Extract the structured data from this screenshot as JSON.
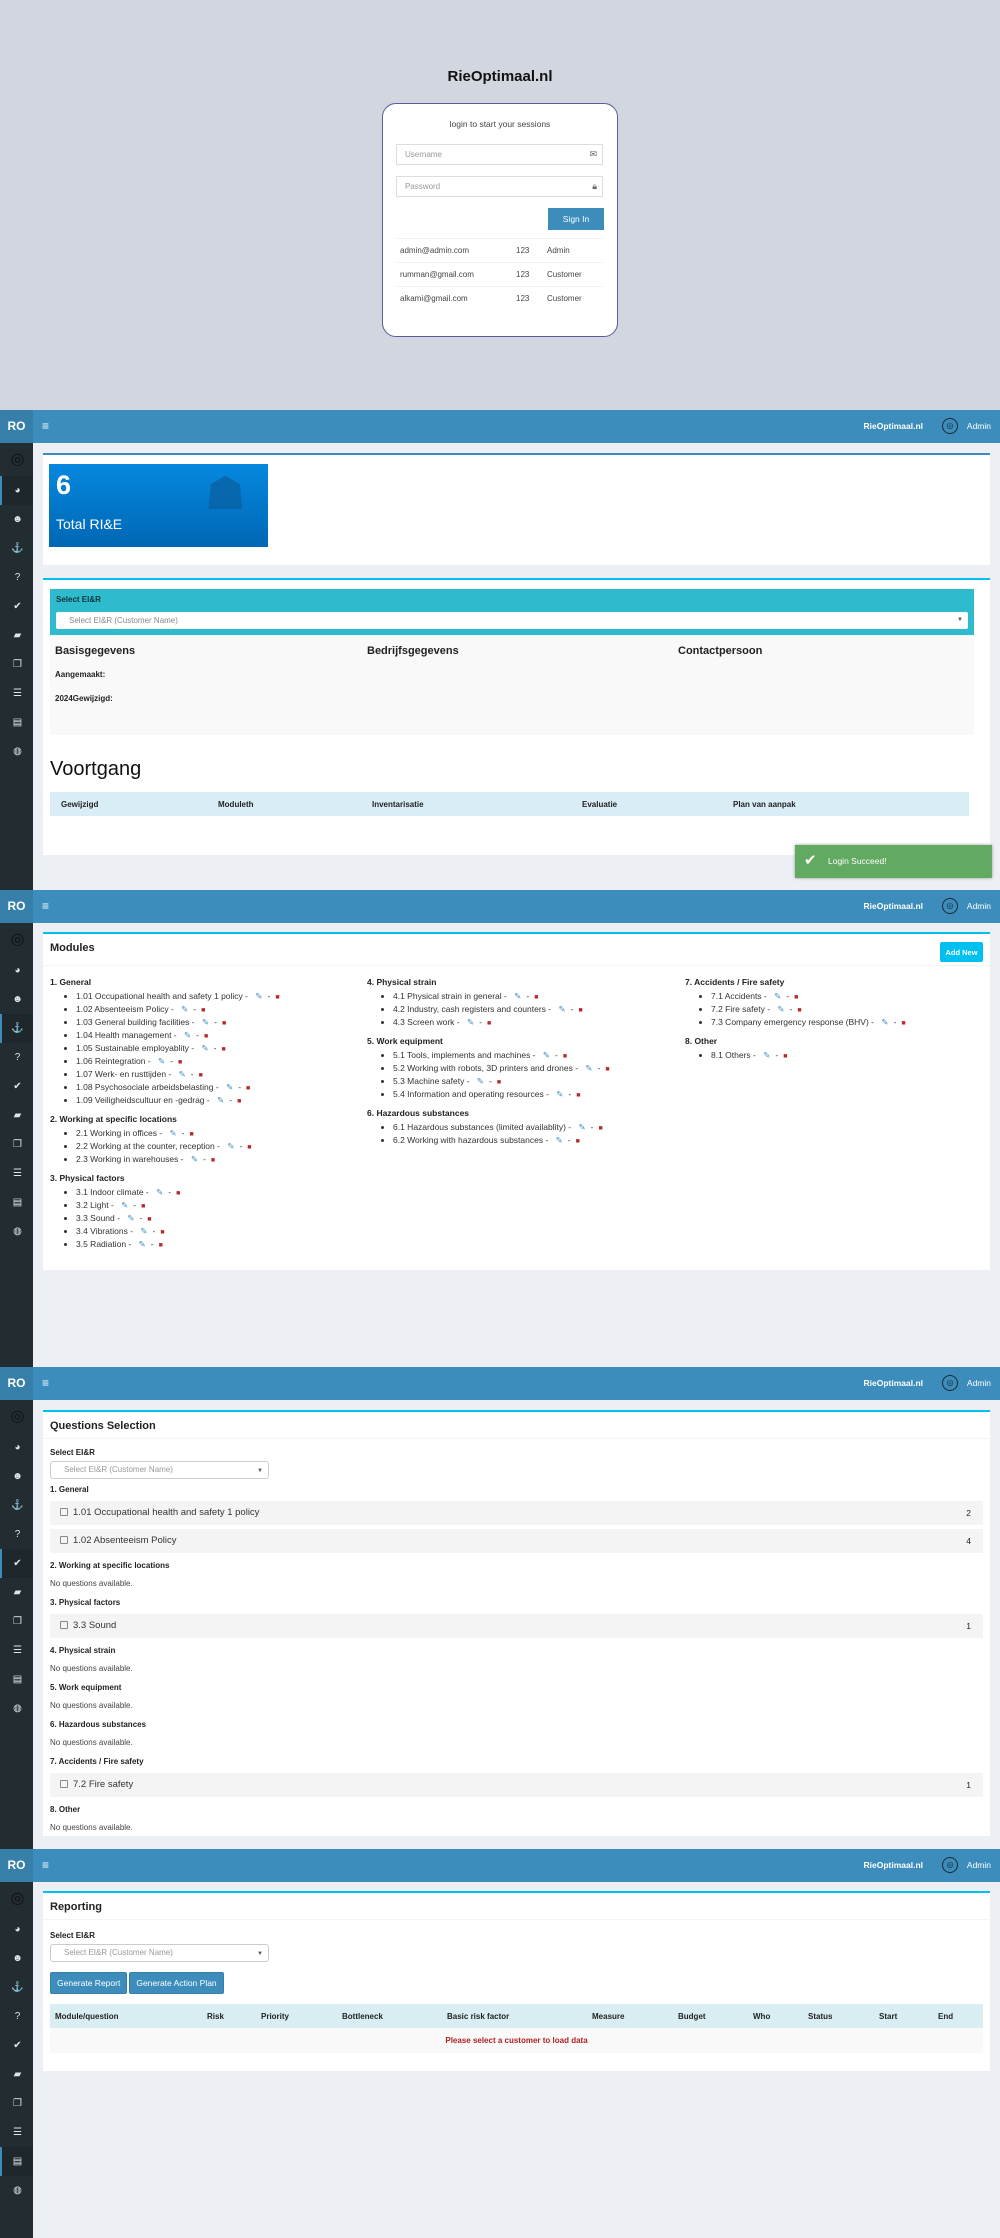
{
  "login": {
    "title": "RieOptimaal.nl",
    "subtitle": "login to start your sessions",
    "username_placeholder": "Username",
    "password_placeholder": "Password",
    "sign_in": "Sign In",
    "credentials": [
      {
        "email": "admin@admin.com",
        "password": "123",
        "role": "Admin"
      },
      {
        "email": "rumman@gmail.com",
        "password": "123",
        "role": "Customer"
      },
      {
        "email": "alkami@gmail.com",
        "password": "123",
        "role": "Customer"
      }
    ]
  },
  "topbar": {
    "brand": "RO",
    "site": "RieOptimaal.nl",
    "user": "Admin",
    "menu_icon": "≡"
  },
  "sidebar_icons": [
    {
      "name": "logo",
      "glyph": "◎"
    },
    {
      "name": "dashboard",
      "glyph": "◕"
    },
    {
      "name": "user",
      "glyph": "☻"
    },
    {
      "name": "anchor",
      "glyph": "⚓"
    },
    {
      "name": "question",
      "glyph": "?"
    },
    {
      "name": "check",
      "glyph": "✔"
    },
    {
      "name": "book",
      "glyph": "▰"
    },
    {
      "name": "copy",
      "glyph": "❐"
    },
    {
      "name": "list",
      "glyph": "☰"
    },
    {
      "name": "file",
      "glyph": "▤"
    },
    {
      "name": "power",
      "glyph": "◍"
    }
  ],
  "dashboard": {
    "total_value": "6",
    "total_label": "Total RI&E",
    "select_label": "Select EI&R",
    "select_placeholder": "Select EI&R (Customer Name)",
    "col_basis": "Basisgegevens",
    "col_bedrijf": "Bedrijfsgegevens",
    "col_contact": "Contactpersoon",
    "field_created": "Aangemaakt:",
    "field_modified": "2024Gewijzigd:",
    "progress_title": "Voortgang",
    "progress_columns": [
      "Gewijzigd",
      "Moduleth",
      "Inventarisatie",
      "Evaluatie",
      "Plan van aanpak"
    ],
    "toast": "Login Succeed!"
  },
  "modules": {
    "title": "Modules",
    "add_new": "Add New",
    "columns": [
      [
        {
          "name": "1. General",
          "items": [
            "1.01 Occupational health and safety 1 policy",
            "1.02 Absenteeism Policy",
            "1.03 General building facilities",
            "1.04 Health management",
            "1.05 Sustainable employablity",
            "1.06 Reintegration",
            "1.07 Werk- en rusttijden",
            "1.08 Psychosociale arbeidsbelasting",
            "1.09 Veiligheidscultuur en -gedrag"
          ]
        },
        {
          "name": "2. Working at specific locations",
          "items": [
            "2.1 Working in offices",
            "2.2 Working at the counter, reception",
            "2.3 Working in warehouses"
          ]
        },
        {
          "name": "3. Physical factors",
          "items": [
            "3.1 Indoor climate",
            "3.2 Light",
            "3.3 Sound",
            "3.4 Vibrations",
            "3.5 Radiation"
          ]
        }
      ],
      [
        {
          "name": "4. Physical strain",
          "items": [
            "4.1 Physical strain in general",
            "4.2 Industry, cash registers and counters",
            "4.3 Screen work"
          ]
        },
        {
          "name": "5. Work equipment",
          "items": [
            "5.1 Tools, implements and machines",
            "5.2 Working with robots, 3D printers and drones",
            "5.3 Machine safety",
            "5.4 Information and operating resources"
          ]
        },
        {
          "name": "6. Hazardous substances",
          "items": [
            "6.1 Hazardous substances (limited availablity)",
            "6.2 Working with hazardous substances"
          ]
        }
      ],
      [
        {
          "name": "7. Accidents / Fire safety",
          "items": [
            "7.1 Accidents",
            "7.2 Fire safety",
            "7.3 Company emergency response (BHV)"
          ]
        },
        {
          "name": "8. Other",
          "items": [
            "8.1 Others"
          ]
        }
      ]
    ]
  },
  "questions": {
    "title": "Questions Selection",
    "select_label": "Select EI&R",
    "select_placeholder": "Select EI&R (Customer Name)",
    "no_questions": "No questions available.",
    "groups": [
      {
        "name": "1. General",
        "rows": [
          {
            "label": "1.01 Occupational health and safety 1 policy",
            "count": "2"
          },
          {
            "label": "1.02 Absenteeism Policy",
            "count": "4"
          }
        ]
      },
      {
        "name": "2. Working at specific locations",
        "rows": []
      },
      {
        "name": "3. Physical factors",
        "rows": [
          {
            "label": "3.3 Sound",
            "count": "1"
          }
        ]
      },
      {
        "name": "4. Physical strain",
        "rows": []
      },
      {
        "name": "5. Work equipment",
        "rows": []
      },
      {
        "name": "6. Hazardous substances",
        "rows": []
      },
      {
        "name": "7. Accidents / Fire safety",
        "rows": [
          {
            "label": "7.2 Fire safety",
            "count": "1"
          }
        ]
      },
      {
        "name": "8. Other",
        "rows": []
      }
    ]
  },
  "reporting": {
    "title": "Reporting",
    "select_label": "Select EI&R",
    "select_placeholder": "Select EI&R (Customer Name)",
    "generate_report": "Generate Report",
    "generate_action_plan": "Generate Action Plan",
    "columns": [
      "Module/question",
      "Risk",
      "Priority",
      "Bottleneck",
      "Basic risk factor",
      "Measure",
      "Budget",
      "Who",
      "Status",
      "Start",
      "End"
    ],
    "empty_message": "Please select a customer to load data"
  }
}
